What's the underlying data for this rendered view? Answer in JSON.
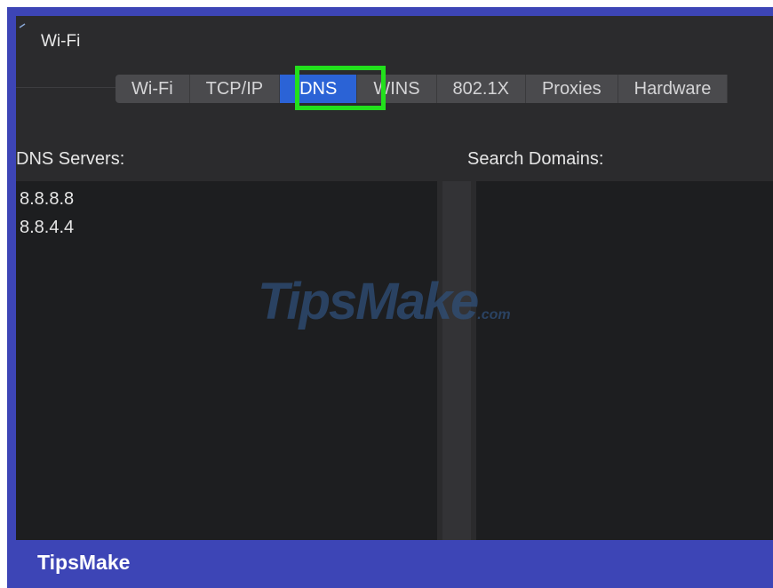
{
  "window": {
    "title": "Wi-Fi"
  },
  "tabs": [
    {
      "label": "Wi-Fi",
      "active": false
    },
    {
      "label": "TCP/IP",
      "active": false
    },
    {
      "label": "DNS",
      "active": true
    },
    {
      "label": "WINS",
      "active": false
    },
    {
      "label": "802.1X",
      "active": false
    },
    {
      "label": "Proxies",
      "active": false
    },
    {
      "label": "Hardware",
      "active": false
    }
  ],
  "dns_servers": {
    "label": "DNS Servers:",
    "entries": [
      "8.8.8.8",
      "8.8.4.4"
    ]
  },
  "search_domains": {
    "label": "Search Domains:",
    "entries": []
  },
  "watermark": {
    "text": "TipsMake",
    "suffix": ".com"
  },
  "footer": {
    "brand": "TipsMake"
  },
  "colors": {
    "frame": "#3d45b6",
    "highlight": "#22e01c",
    "active_tab": "#2b63d6",
    "window_bg": "#2b2b2d",
    "panel_bg": "#1d1e20"
  },
  "icons": {
    "back": "back-arrow-icon"
  }
}
